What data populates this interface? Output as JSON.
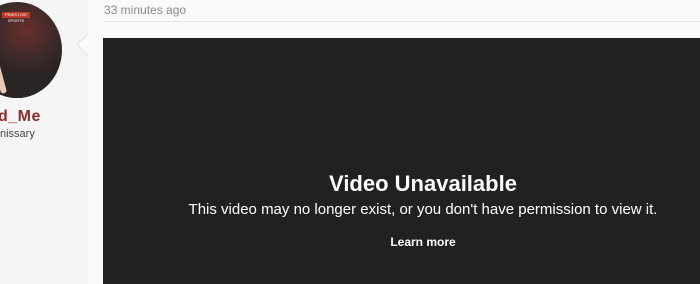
{
  "user": {
    "avatar_sign": "PINKS LIVE SPORTS",
    "name": "d_Me",
    "title": "nissary"
  },
  "post": {
    "timestamp": "33 minutes ago",
    "video": {
      "title": "Video Unavailable",
      "message": "This video may no longer exist, or you don't have permission to view it.",
      "learn_more": "Learn more"
    }
  },
  "colors": {
    "username": "#8b2e2e",
    "video_bg": "#212121",
    "page_bg": "#f5f5f5"
  }
}
